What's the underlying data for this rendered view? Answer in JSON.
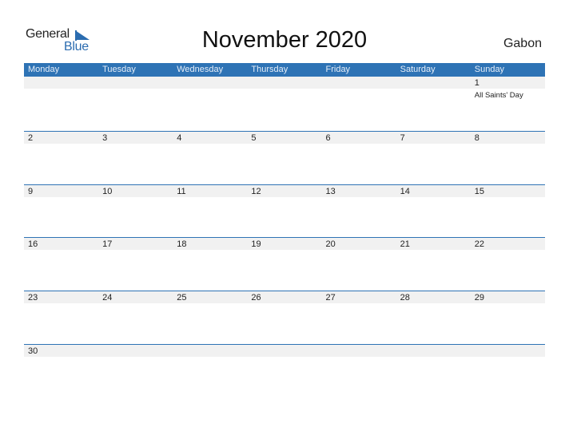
{
  "logo": {
    "word1": "General",
    "word2": "Blue"
  },
  "title": "November 2020",
  "country": "Gabon",
  "colors": {
    "accent": "#2e73b5",
    "strip": "#f1f1f1"
  },
  "weekdays": [
    "Monday",
    "Tuesday",
    "Wednesday",
    "Thursday",
    "Friday",
    "Saturday",
    "Sunday"
  ],
  "weeks": [
    {
      "days": [
        "",
        "",
        "",
        "",
        "",
        "",
        "1"
      ],
      "events": [
        "",
        "",
        "",
        "",
        "",
        "",
        "All Saints' Day"
      ]
    },
    {
      "days": [
        "2",
        "3",
        "4",
        "5",
        "6",
        "7",
        "8"
      ],
      "events": [
        "",
        "",
        "",
        "",
        "",
        "",
        ""
      ]
    },
    {
      "days": [
        "9",
        "10",
        "11",
        "12",
        "13",
        "14",
        "15"
      ],
      "events": [
        "",
        "",
        "",
        "",
        "",
        "",
        ""
      ]
    },
    {
      "days": [
        "16",
        "17",
        "18",
        "19",
        "20",
        "21",
        "22"
      ],
      "events": [
        "",
        "",
        "",
        "",
        "",
        "",
        ""
      ]
    },
    {
      "days": [
        "23",
        "24",
        "25",
        "26",
        "27",
        "28",
        "29"
      ],
      "events": [
        "",
        "",
        "",
        "",
        "",
        "",
        ""
      ]
    },
    {
      "days": [
        "30",
        "",
        "",
        "",
        "",
        "",
        ""
      ],
      "events": [
        "",
        "",
        "",
        "",
        "",
        "",
        ""
      ]
    }
  ]
}
